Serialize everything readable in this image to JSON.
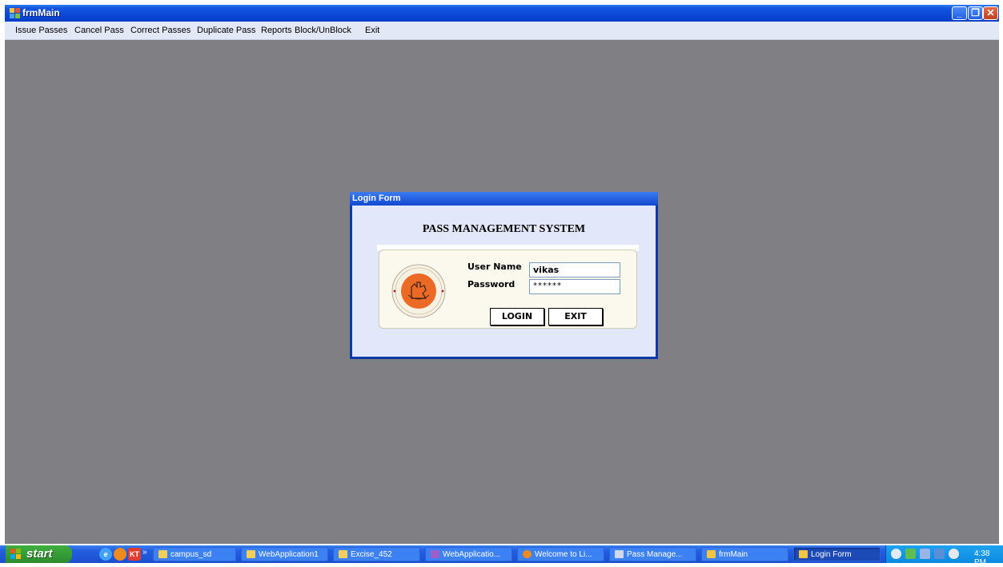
{
  "window": {
    "title": "frmMain",
    "controls": {
      "minimize": "_",
      "restore": "❐",
      "close": "✕"
    }
  },
  "menu": [
    "Issue Passes",
    "Cancel Pass",
    "Correct Passes",
    "Duplicate Pass",
    "Reports",
    "Block/UnBlock",
    "Exit"
  ],
  "login": {
    "title": "Login Form",
    "heading": "PASS MANAGEMENT SYSTEM",
    "username_label": "User Name",
    "username_value": "vikas",
    "password_label": "Password",
    "password_value": "******",
    "login_button": "LOGIN",
    "exit_button": "EXIT"
  },
  "taskbar": {
    "start_label": "start",
    "quicklaunch_more": "»",
    "quicklaunch_kt": "KT",
    "tasks": [
      "campus_sd",
      "WebApplication1",
      "Excise_452",
      "WebApplicatio...",
      "Welcome to Li...",
      "Pass Manage...",
      "frmMain",
      "Login Form"
    ],
    "active_task": "Login Form",
    "clock": "4:38 PM"
  },
  "colors": {
    "desktop_client": "#807f84",
    "titlebar": "#0a48d6",
    "menubar": "#e3e8f7",
    "dialog_body": "#e2e7fa",
    "seal_orange": "#ec6a26",
    "taskbar": "#245ee0",
    "start_green": "#3fae3f"
  },
  "icons": [
    "window-app-icon",
    "seal-logo",
    "windows-flag-icon",
    "ie-icon",
    "firefox-icon",
    "kt-icon",
    "folder-icon",
    "vs-icon",
    "network-icon",
    "volume-icon",
    "clock-tray-icon"
  ]
}
